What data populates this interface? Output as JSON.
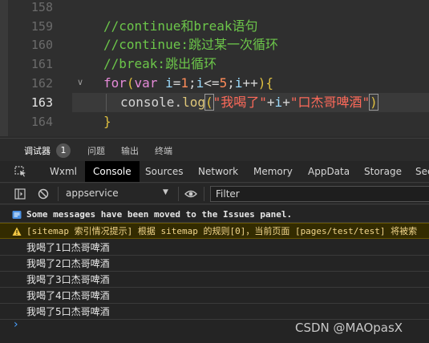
{
  "editor": {
    "lines": [
      {
        "number": "158"
      },
      {
        "number": "159",
        "text": "//continue和break语句"
      },
      {
        "number": "160",
        "text": "//continue:跳过某一次循环"
      },
      {
        "number": "161",
        "text": "//break:跳出循环"
      },
      {
        "number": "162"
      },
      {
        "number": "163"
      },
      {
        "number": "164"
      }
    ],
    "for_line": {
      "kw_for": "for",
      "paren_open": "(",
      "kw_var": "var",
      "i1": "i",
      "eq": "=",
      "one": "1",
      "semi1": ";",
      "i2": "i",
      "le": "<=",
      "five": "5",
      "semi2": ";",
      "i3": "i",
      "inc": "++",
      "paren_close": ")",
      "brace_open": "{"
    },
    "log_line": {
      "obj": "console",
      "dot": ".",
      "fn": "log",
      "paren_open": "(",
      "str1": "\"我喝了\"",
      "plus1": "+",
      "i": "i",
      "plus2": "+",
      "str2": "\"口杰哥啤酒\"",
      "paren_close": ")"
    },
    "close_brace": "}"
  },
  "panel": {
    "tabs": [
      {
        "label": "调试器"
      },
      {
        "label": "问题"
      },
      {
        "label": "输出"
      },
      {
        "label": "终端"
      }
    ],
    "badge": "1"
  },
  "devtools": {
    "tabs": [
      "Wxml",
      "Console",
      "Sources",
      "Network",
      "Memory",
      "AppData",
      "Storage",
      "Sec"
    ],
    "active": "Console"
  },
  "toolbar": {
    "context": "appservice",
    "filter_placeholder": "Filter"
  },
  "console": {
    "info": "Some messages have been moved to the Issues panel.",
    "warning": "[sitemap 索引情况提示] 根据 sitemap 的规则[0]，当前页面 [pages/test/test] 将被索",
    "logs": [
      "我喝了1口杰哥啤酒",
      "我喝了2口杰哥啤酒",
      "我喝了3口杰哥啤酒",
      "我喝了4口杰哥啤酒",
      "我喝了5口杰哥啤酒"
    ],
    "prompt": "›"
  },
  "watermark": "CSDN @MAOpasX",
  "colors": {
    "comment": "#6cc64a",
    "keyword": "#e58ad8",
    "string": "#ff6a5a",
    "number": "#ff8c5a",
    "active_tab_bg": "#000000",
    "warning_bg": "#332b00"
  }
}
